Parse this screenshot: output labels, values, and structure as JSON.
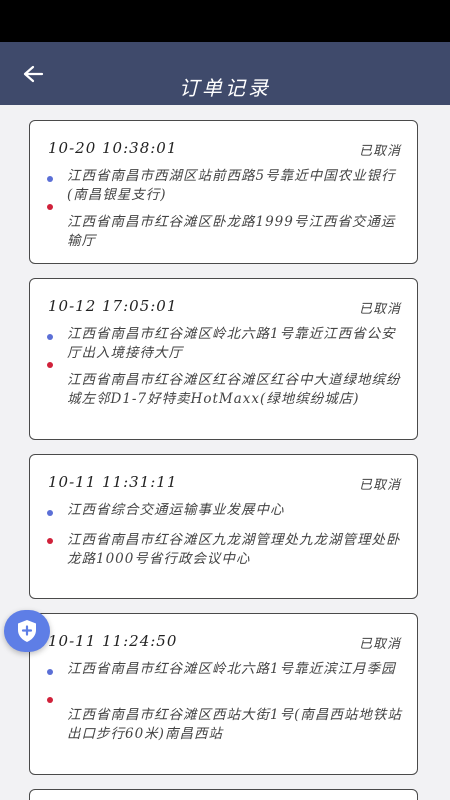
{
  "header": {
    "title": "订单记录",
    "back_icon": "arrow-left-icon"
  },
  "orders": [
    {
      "time": "10-20  10:38:01",
      "status": "已取消",
      "start": "江西省南昌市西湖区站前西路5号靠近中国农业银行(南昌银星支行)",
      "end": "江西省南昌市红谷滩区卧龙路1999号江西省交通运输厅"
    },
    {
      "time": "10-12  17:05:01",
      "status": "已取消",
      "start": "江西省南昌市红谷滩区岭北六路1号靠近江西省公安厅出入境接待大厅",
      "end": "江西省南昌市红谷滩区红谷滩区红谷中大道绿地缤纷城左邻D1-7好特卖HotMaxx(绿地缤纷城店)"
    },
    {
      "time": "10-11  11:31:11",
      "status": "已取消",
      "start": "江西省综合交通运输事业发展中心",
      "end": "江西省南昌市红谷滩区九龙湖管理处九龙湖管理处卧龙路1000号省行政会议中心"
    },
    {
      "time": "10-11  11:24:50",
      "status": "已取消",
      "start": "江西省南昌市红谷滩区岭北六路1号靠近滨江月季园",
      "end": "江西省南昌市红谷滩区西站大街1号(南昌西站地铁站出口步行60米)南昌西站"
    }
  ],
  "colors": {
    "header_bg": "#3f4a6b",
    "start_dot": "#5b6fd6",
    "end_dot": "#d0213a",
    "fab_bg": "#5e7ee6"
  },
  "fab": {
    "icon": "shield-plus-icon"
  }
}
